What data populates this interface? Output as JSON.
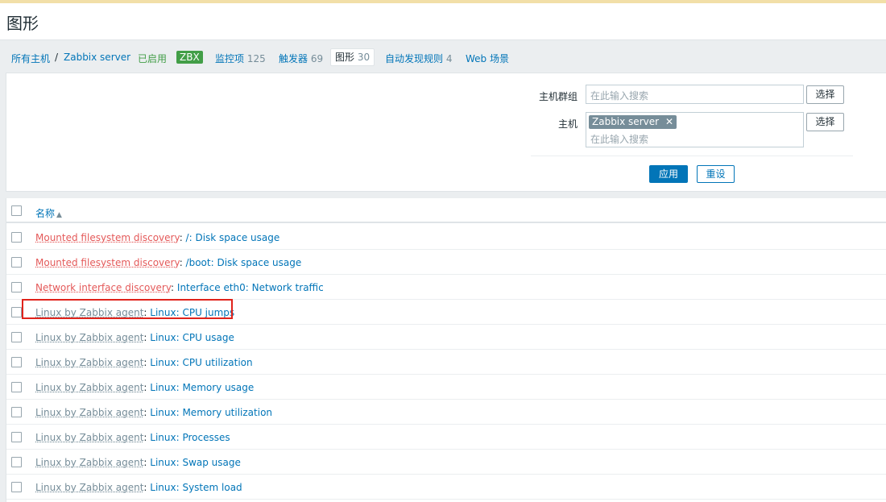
{
  "header": {
    "title": "图形"
  },
  "nav": {
    "all_hosts": "所有主机",
    "separator": "/",
    "host": "Zabbix server",
    "status": "已启用",
    "zbx_badge": "ZBX",
    "items_label": "监控项",
    "items_count": "125",
    "triggers_label": "触发器",
    "triggers_count": "69",
    "graphs_label": "图形",
    "graphs_count": "30",
    "discovery_label": "自动发现规则",
    "discovery_count": "4",
    "web_label": "Web 场景"
  },
  "filter": {
    "host_group_label": "主机群组",
    "host_group_placeholder": "在此输入搜索",
    "host_label": "主机",
    "host_chip": "Zabbix server",
    "host_placeholder": "在此输入搜索",
    "select_label": "选择",
    "apply_label": "应用",
    "reset_label": "重设"
  },
  "table": {
    "column_name": "名称",
    "rows": [
      {
        "prefix": "Mounted filesystem discovery",
        "prefix_type": "orange",
        "name": "/: Disk space usage"
      },
      {
        "prefix": "Mounted filesystem discovery",
        "prefix_type": "orange",
        "name": "/boot: Disk space usage"
      },
      {
        "prefix": "Network interface discovery",
        "prefix_type": "orange",
        "name": "Interface eth0: Network traffic"
      },
      {
        "prefix": "Linux by Zabbix agent",
        "prefix_type": "gray",
        "name": "Linux: CPU jumps"
      },
      {
        "prefix": "Linux by Zabbix agent",
        "prefix_type": "gray",
        "name": "Linux: CPU usage"
      },
      {
        "prefix": "Linux by Zabbix agent",
        "prefix_type": "gray",
        "name": "Linux: CPU utilization"
      },
      {
        "prefix": "Linux by Zabbix agent",
        "prefix_type": "gray",
        "name": "Linux: Memory usage"
      },
      {
        "prefix": "Linux by Zabbix agent",
        "prefix_type": "gray",
        "name": "Linux: Memory utilization"
      },
      {
        "prefix": "Linux by Zabbix agent",
        "prefix_type": "gray",
        "name": "Linux: Processes"
      },
      {
        "prefix": "Linux by Zabbix agent",
        "prefix_type": "gray",
        "name": "Linux: Swap usage"
      },
      {
        "prefix": "Linux by Zabbix agent",
        "prefix_type": "gray",
        "name": "Linux: System load"
      }
    ]
  },
  "colors": {
    "link": "#0275b8",
    "discovery_prefix": "#e45959",
    "template_prefix": "#768d99",
    "enabled": "#429e47",
    "highlight": "#e0231b"
  }
}
